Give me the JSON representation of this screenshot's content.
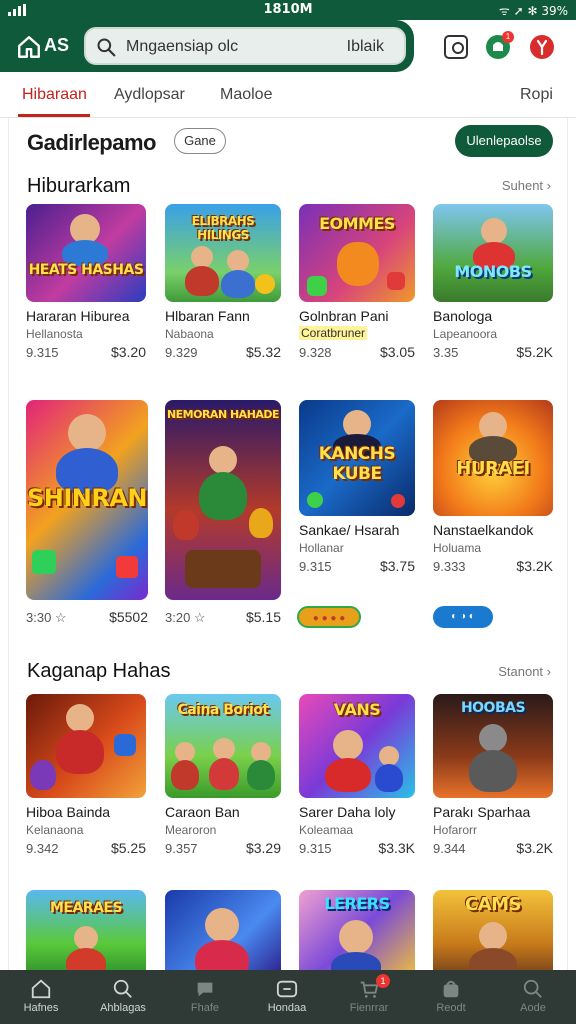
{
  "status_bar": {
    "time": "1810M",
    "right_text": "ᯤ ➚ ✻ 39%"
  },
  "header": {
    "brand": "AS",
    "search_query": "Mngaensiap olc",
    "search_suffix": "Iblaik",
    "notification_count": "1"
  },
  "tabs": [
    {
      "label": "Hibaraan"
    },
    {
      "label": "Aydlopsar"
    },
    {
      "label": "Maoloe"
    },
    {
      "label": "Ropi"
    }
  ],
  "page": {
    "title": "Gadirlepamo",
    "tag": "Gane",
    "cta": "Ulenlepaolse"
  },
  "sections": [
    {
      "title": "Hiburarkam",
      "see_all": "Suhent  ›",
      "rows": [
        [
          {
            "art": "HEATS HASHAS",
            "name": "Hararan Hiburea",
            "sub": "Hellanosta",
            "price_a": "9.315",
            "price_b": "$3.20"
          },
          {
            "art": "ELIBRAHS HILINGS",
            "name": "Hlbaran Fann",
            "sub": "Nabaona",
            "price_a": "9.329",
            "price_b": "$5.32"
          },
          {
            "art": "EOMMES",
            "name": "Golnbran Pani",
            "sub": "Coratbruner",
            "price_a": "9.328",
            "price_b": "$3.05"
          },
          {
            "art": "MONOBS",
            "name": "Banologa",
            "sub": "Lapeanoora",
            "price_a": "3.35",
            "price_b": "$5.2K"
          }
        ],
        [
          {
            "art": "SHINRAN",
            "name": "",
            "sub": "",
            "price_a": "3:30 ☆",
            "price_b": "$5502"
          },
          {
            "art": "NEMORAN HAHADE",
            "name": "",
            "sub": "",
            "price_a": "3:20 ☆",
            "price_b": "$5.15"
          },
          {
            "art": "KANCHS KUBE",
            "name": "Sankae/ Hsarah",
            "sub": "Hollanar",
            "price_a": "9.315",
            "price_b": "$3.75"
          },
          {
            "art": "HURAEI",
            "name": "Nanstaelkandok",
            "sub": "Holuama",
            "price_a": "9.333",
            "price_b": "$3.2K"
          }
        ]
      ],
      "pills": [
        "●  ● ● ●",
        "◐  ◑ ◐"
      ]
    },
    {
      "title": "Kaganap Hahas",
      "see_all": "Stanont  ›",
      "rows": [
        [
          {
            "art": "",
            "name": "Hiboa Bainda",
            "sub": "Kelanaona",
            "price_a": "9.342",
            "price_b": "$5.25"
          },
          {
            "art": "Caina Boriot",
            "name": "Caraon Ban",
            "sub": "Mearoron",
            "price_a": "9.357",
            "price_b": "$3.29"
          },
          {
            "art": "VANS",
            "name": "Sarer Daha loly",
            "sub": "Koleamaa",
            "price_a": "9.315",
            "price_b": "$3.3K"
          },
          {
            "art": "HOOBAS",
            "name": "Parakı Sparhaa",
            "sub": "Hofarorr",
            "price_a": "9.344",
            "price_b": "$3.2K"
          }
        ],
        [
          {
            "art": "MEARAES"
          },
          {
            "art": ""
          },
          {
            "art": "LERERS"
          },
          {
            "art": "CAMS"
          }
        ]
      ]
    }
  ],
  "bottom_nav": [
    {
      "label": "Hafnes",
      "icon": "home-icon"
    },
    {
      "label": "Ahblagas",
      "icon": "search-icon"
    },
    {
      "label": "Fhafe",
      "icon": "chat-icon"
    },
    {
      "label": "Hondaa",
      "icon": "gamepad-icon"
    },
    {
      "label": "Fienrrar",
      "icon": "cart-icon",
      "badge": "1"
    },
    {
      "label": "Reodt",
      "icon": "bag-icon"
    },
    {
      "label": "Aode",
      "icon": "search-icon"
    }
  ],
  "colors": {
    "brand_green": "#0f5a3a",
    "accent_red": "#c2241e",
    "nav_bg": "#2f3a36"
  }
}
